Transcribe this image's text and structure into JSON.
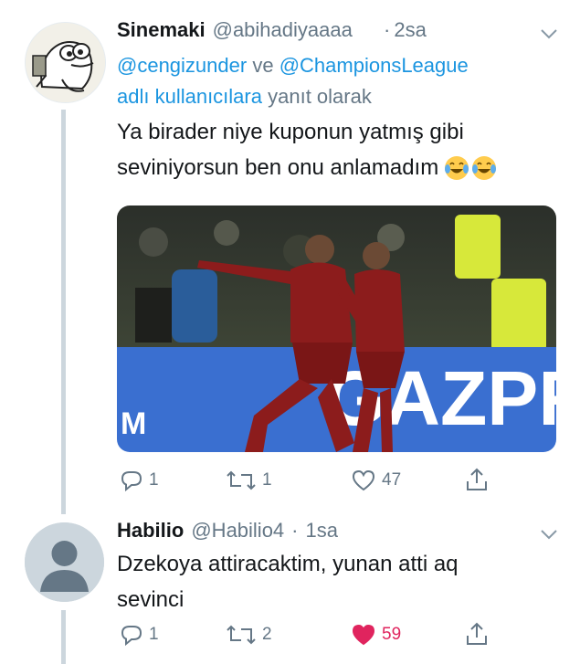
{
  "tweet1": {
    "display_name": "Sinemaki",
    "handle": "@abihadiyaaaa",
    "separator": "·",
    "time": "2sa",
    "reply_to": {
      "mention1": "@cengizunder",
      "conjunction": "ve",
      "mention2": "@ChampionsLeague",
      "suffix_link": "adlı kullanıcılara",
      "suffix": "yanıt olarak"
    },
    "text_line1": "Ya birader niye kuponun yatmış gibi",
    "text_line2": "seviniyorsun ben onu anlamadım",
    "emoji": "joy-emoji",
    "photo_banner_text": "GAZPR",
    "photo_banner_left": "M",
    "actions": {
      "replies": "1",
      "retweets": "1",
      "likes": "47"
    }
  },
  "tweet2": {
    "display_name": "Habilio",
    "handle": "@Habilio4",
    "separator": "·",
    "time": "1sa",
    "text_line1": "Dzekoya attiracaktim, yunan atti aq",
    "text_line2": "sevinci",
    "actions": {
      "replies": "1",
      "retweets": "2",
      "likes": "59"
    }
  },
  "colors": {
    "link": "#1b95e0",
    "secondary": "#657786",
    "like_active": "#e0245e",
    "thread_line": "#ccd6dd",
    "banner": "#3a6fd0"
  },
  "icons": [
    "caret-down-icon",
    "reply-icon",
    "retweet-icon",
    "like-icon",
    "share-icon",
    "default-avatar-icon"
  ]
}
